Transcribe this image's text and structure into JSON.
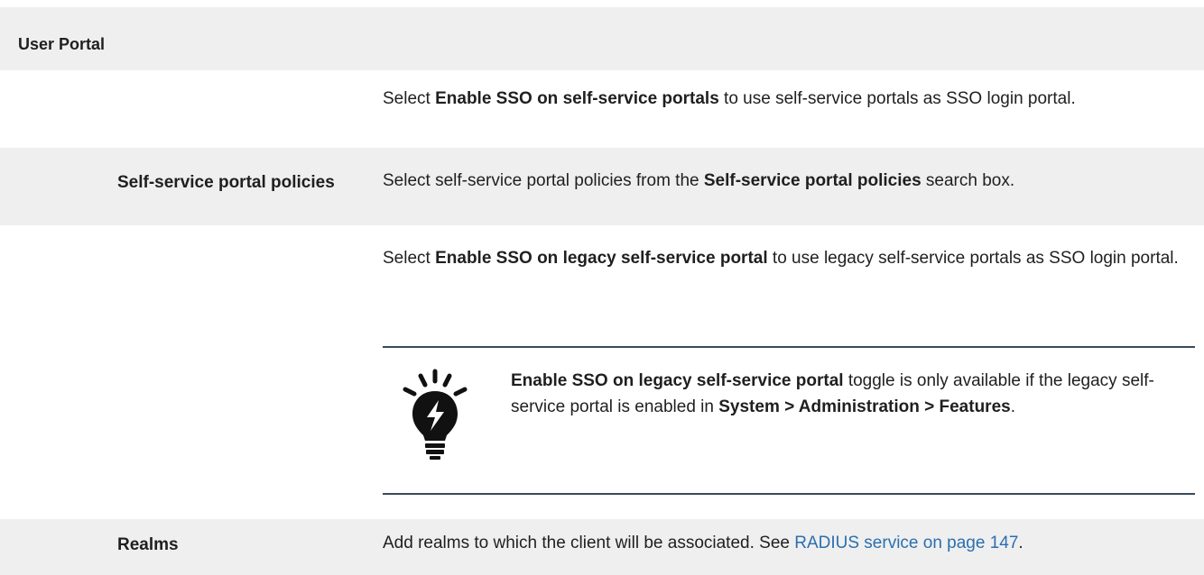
{
  "section": {
    "title": "User Portal"
  },
  "rows": [
    {
      "label": "",
      "desc": {
        "pre": "Select ",
        "bold": "Enable SSO on self-service portals",
        "post": " to use self-service portals as SSO login portal."
      }
    },
    {
      "label": "Self-service portal policies",
      "desc": {
        "pre": "Select self-service portal policies from the ",
        "bold": "Self-service portal policies",
        "post": " search box."
      }
    },
    {
      "label": "",
      "desc": {
        "pre": "Select ",
        "bold": "Enable SSO on legacy self-service portal",
        "post": " to use legacy self-service portals as SSO login portal."
      },
      "note": {
        "icon": "lightbulb-tip-icon",
        "bold1": "Enable SSO on legacy self-service portal",
        "text1": " toggle is only available if the legacy self-service portal is enabled in ",
        "bold2": "System > Administration > Features",
        "text2": "."
      }
    },
    {
      "label": "Realms",
      "desc": {
        "pre": "Add realms to which the client will be associated. See ",
        "link": "RADIUS service on page 147",
        "post": "."
      }
    }
  ],
  "colors": {
    "shade": "#efefef",
    "link": "#2b6fae",
    "rule": "#3a4a5c"
  }
}
